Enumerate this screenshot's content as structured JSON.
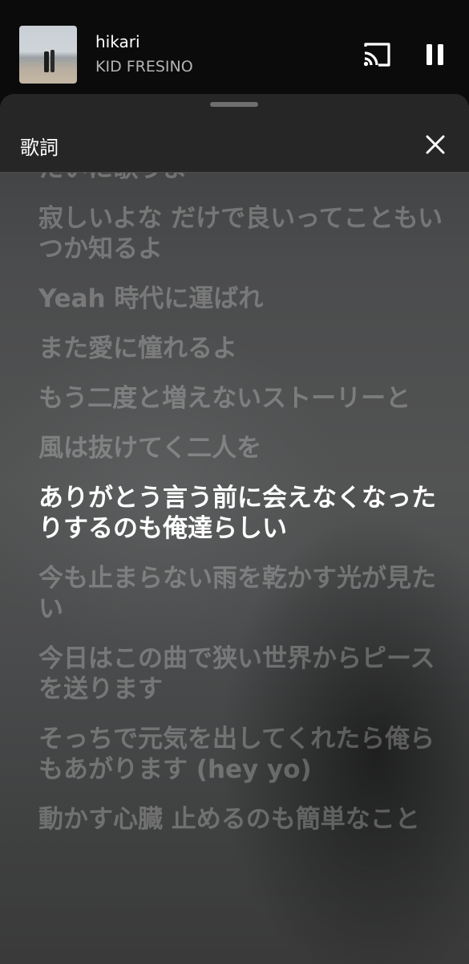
{
  "now_playing": {
    "title": "hikari",
    "artist": "KID FRESINO"
  },
  "icons": {
    "cast": "cast-icon",
    "pause": "pause-icon",
    "close": "close-icon"
  },
  "sheet": {
    "title": "歌詞"
  },
  "lyrics": [
    {
      "text": "たいに歌うよ",
      "active": false
    },
    {
      "text": "寂しいよな だけで良いってこともいつか知るよ",
      "active": false
    },
    {
      "text": "Yeah 時代に運ばれ",
      "active": false
    },
    {
      "text": "また愛に憧れるよ",
      "active": false
    },
    {
      "text": "もう二度と増えないストーリーと",
      "active": false
    },
    {
      "text": "風は抜けてく二人を",
      "active": false
    },
    {
      "text": "ありがとう言う前に会えなくなったりするのも俺達らしい",
      "active": true
    },
    {
      "text": "今も止まらない雨を乾かす光が見たい",
      "active": false
    },
    {
      "text": "今日はこの曲で狭い世界からピースを送ります",
      "active": false
    },
    {
      "text": "そっちで元気を出してくれたら俺らもあがります (hey yo)",
      "active": false
    },
    {
      "text": "動かす心臓 止めるのも簡単なこと",
      "active": false
    }
  ],
  "colors": {
    "background": "#0b0b0b",
    "sheet_header": "#262626",
    "active_lyric": "#ffffff",
    "inactive_lyric": "rgba(255,255,255,0.25)"
  }
}
